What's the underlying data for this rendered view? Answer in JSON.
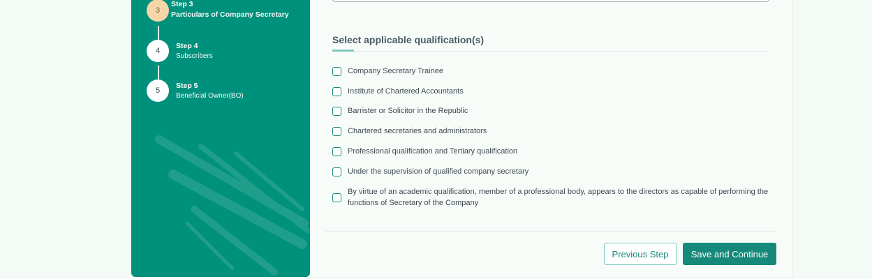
{
  "colors": {
    "sidebar": "#00917c",
    "active_step": "#f6d5a8",
    "accent": "#16897a"
  },
  "steps": [
    {
      "number": "3",
      "title": "Step 3",
      "subtitle": "Particulars of Company Secretary",
      "state": "active"
    },
    {
      "number": "4",
      "title": "Step 4",
      "subtitle": "Subscribers",
      "state": "pending"
    },
    {
      "number": "5",
      "title": "Step 5",
      "subtitle": "Beneficial Owner(BO)",
      "state": "pending"
    }
  ],
  "qualifications": {
    "title": "Select applicable qualification(s)",
    "options": [
      {
        "label": "Company Secretary Trainee",
        "checked": false
      },
      {
        "label": "Institute of Chartered Accountants",
        "checked": false
      },
      {
        "label": "Barrister or Solicitor in the Republic",
        "checked": false
      },
      {
        "label": "Chartered secretaries and administrators",
        "checked": false
      },
      {
        "label": "Professional qualification and Tertiary qualification",
        "checked": false
      },
      {
        "label": "Under the supervision of qualified company secretary",
        "checked": false
      },
      {
        "label": "By virtue of an academic qualification, member of a professional body, appears to the directors as capable of performing the functions of Secretary of the Company",
        "checked": false
      }
    ]
  },
  "actions": {
    "previous": "Previous Step",
    "save": "Save and Continue"
  }
}
